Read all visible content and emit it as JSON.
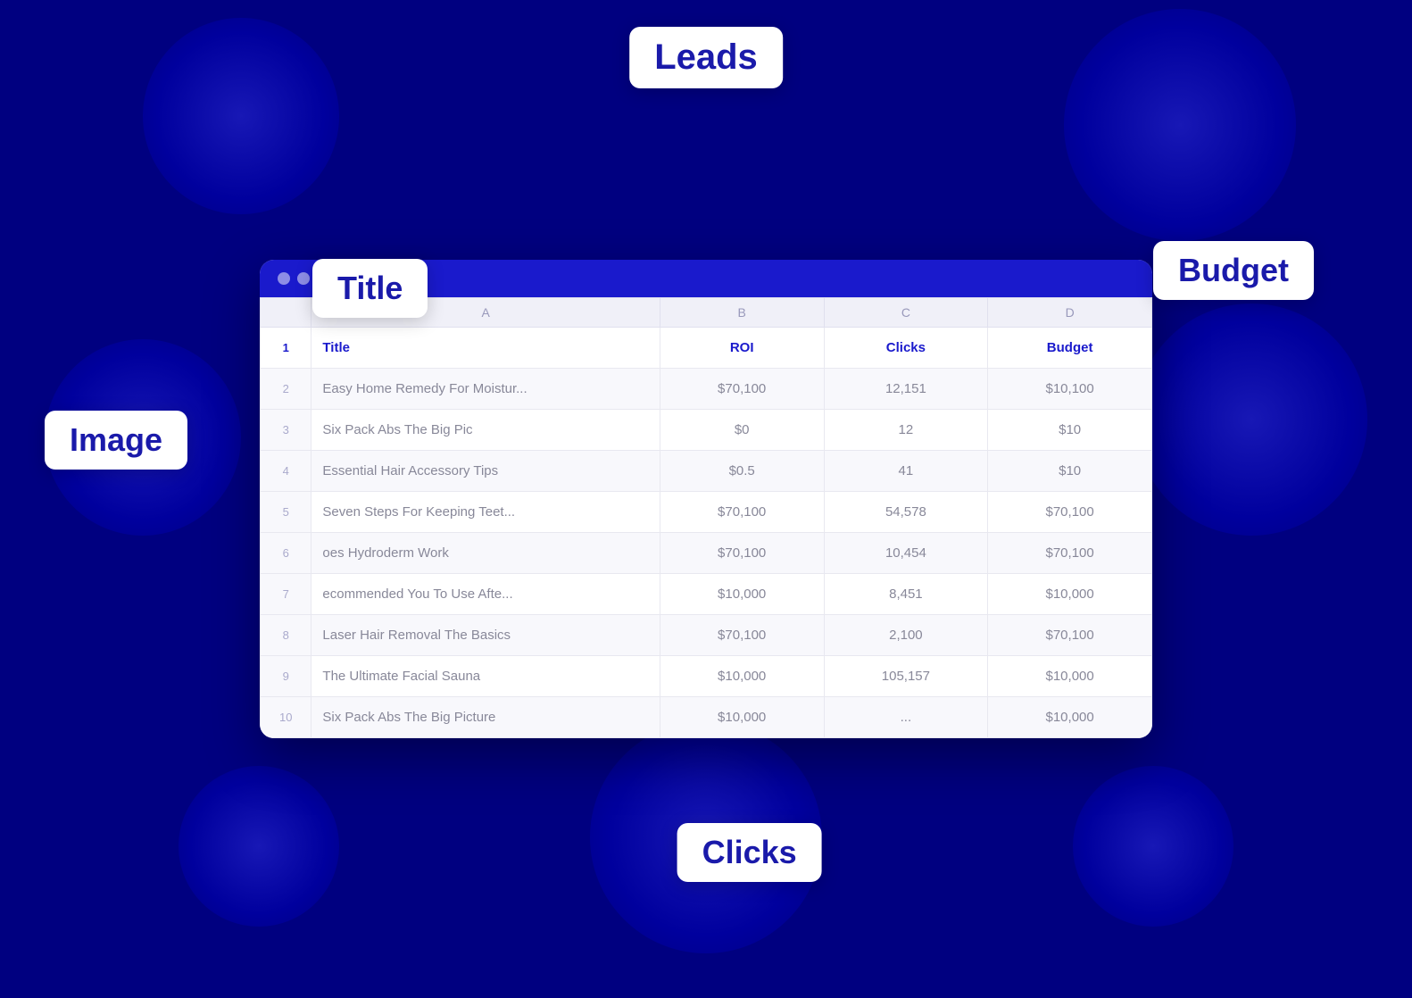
{
  "window": {
    "titlebar": {
      "dots": [
        "dot1",
        "dot2",
        "dot3"
      ]
    }
  },
  "floating_labels": {
    "leads": "Leads",
    "title": "Title",
    "budget": "Budget",
    "image": "Image",
    "clicks": "Clicks"
  },
  "spreadsheet": {
    "columns": {
      "row_num": "",
      "a": "A",
      "b": "B",
      "c": "C",
      "d": "D"
    },
    "header_row": {
      "row_num": "1",
      "title": "Title",
      "roi": "ROI",
      "clicks": "Clicks",
      "budget": "Budget"
    },
    "rows": [
      {
        "num": "2",
        "title": "Easy Home Remedy For Moistur...",
        "roi": "$70,100",
        "clicks": "12,151",
        "budget": "$10,100"
      },
      {
        "num": "3",
        "title": "Six Pack Abs The Big Pic",
        "roi": "$0",
        "clicks": "12",
        "budget": "$10"
      },
      {
        "num": "4",
        "title": "Essential Hair Accessory Tips",
        "roi": "$0.5",
        "clicks": "41",
        "budget": "$10"
      },
      {
        "num": "5",
        "title": "Seven Steps For Keeping Teet...",
        "roi": "$70,100",
        "clicks": "54,578",
        "budget": "$70,100"
      },
      {
        "num": "6",
        "title": "oes Hydroderm Work",
        "roi": "$70,100",
        "clicks": "10,454",
        "budget": "$70,100"
      },
      {
        "num": "7",
        "title": "ecommended You To Use Afte...",
        "roi": "$10,000",
        "clicks": "8,451",
        "budget": "$10,000"
      },
      {
        "num": "8",
        "title": "Laser Hair Removal The Basics",
        "roi": "$70,100",
        "clicks": "2,100",
        "budget": "$70,100"
      },
      {
        "num": "9",
        "title": "The Ultimate Facial Sauna",
        "roi": "$10,000",
        "clicks": "105,157",
        "budget": "$10,000"
      },
      {
        "num": "10",
        "title": "Six Pack Abs The Big Picture",
        "roi": "$10,000",
        "clicks": "...",
        "budget": "$10,000"
      }
    ]
  },
  "blobs": {
    "colors": {
      "primary": "#1a1aff",
      "bg": "#000080"
    }
  }
}
